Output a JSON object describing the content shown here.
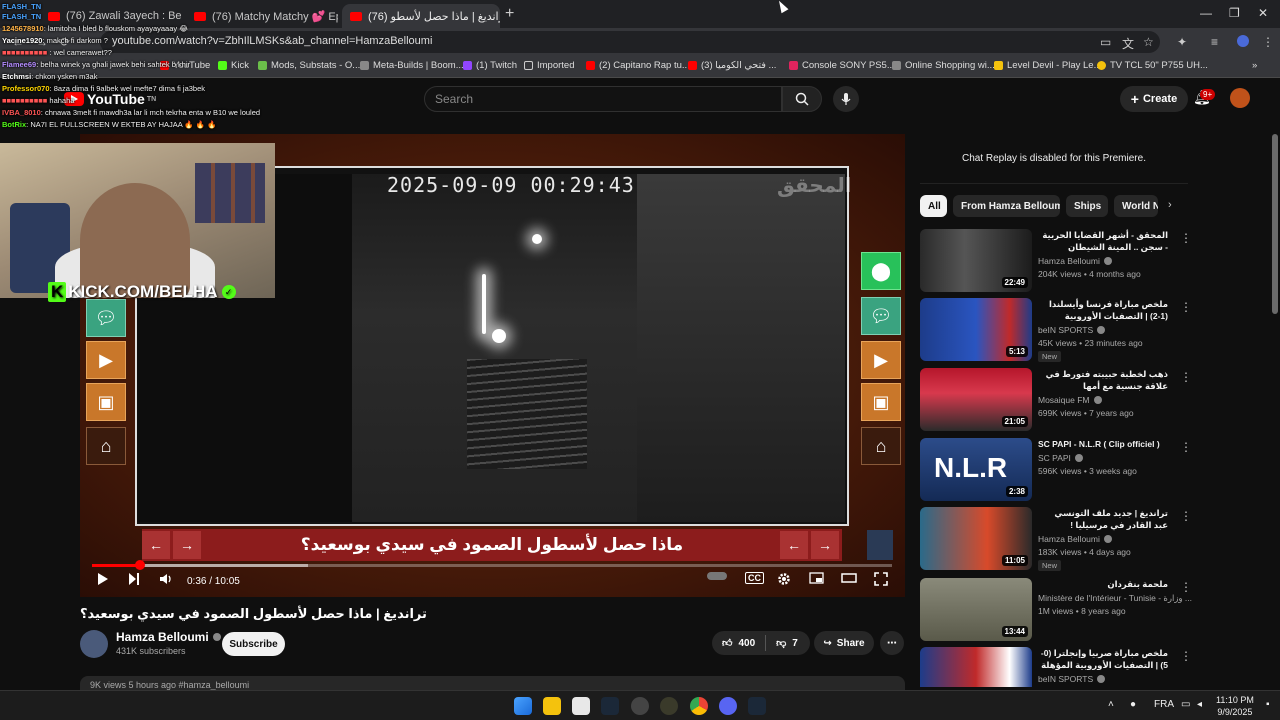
{
  "browser": {
    "tabs": [
      {
        "label": "(76) Zawali 3ayech : Bendirman"
      },
      {
        "label": "(76) Matchy Matchy 💕 Ep 59: "
      },
      {
        "label": "ترانديغ | ماذا حصل لأسطو (76)"
      }
    ],
    "address": "youtube.com/watch?v=ZbhIlLMSKs&ab_channel=HamzaBelloumi",
    "bookmarks": [
      "YouTube",
      "Kick",
      "Mods, Substats - O...",
      "Meta-Builds | Boom...",
      "(1) Twitch",
      "Imported",
      "(2) Capitano Rap tu...",
      "(3) فتحي الكوميا ...",
      "Console SONY PS5...",
      "Online Shopping wi...",
      "Level Devil - Play Le...",
      "TV TCL 50\" P755 UH..."
    ]
  },
  "youtube": {
    "logo": "YouTube",
    "logo_region": "TN",
    "search_placeholder": "Search",
    "create_label": "Create",
    "notif_count": "9+"
  },
  "player": {
    "timestamp": "2025-09-09 00:29:43",
    "watermark": "المحقق",
    "caption": "ماذا حصل لأسطول الصمود في سيدي بوسعيد؟",
    "current_time": "0:36",
    "duration": "10:05",
    "time_display": "0:36 / 10:05",
    "progress_played": 0.06,
    "progress_loaded": 0.27
  },
  "webcam": {
    "label": "KICK.COM/BELHA"
  },
  "chat": [
    {
      "user": "FLASH_TN",
      "text": ""
    },
    {
      "user": "FLASH_TN",
      "text": ""
    },
    {
      "user": "1245678910",
      "text": ": lamitoha I bled b flouskom ayayayaaay 😂"
    },
    {
      "user": "Yacine1920",
      "text": ": makch fi darkom ?"
    },
    {
      "user": "",
      "text": "wel camerawet??"
    },
    {
      "user": "Flamee69",
      "text": ": belha winek ya ghali jawek behi sahtek b khir"
    },
    {
      "user": "Etchmsi",
      "text": ": chkon ysken m3ak"
    },
    {
      "user": "Professor070",
      "text": ": 8aza dima fi 9albek wel mefte7 dima fi ja3bek"
    },
    {
      "user": "",
      "text": "hahaha"
    },
    {
      "user": "IVBA_8010",
      "text": ": chnawa 3melt fi mawdh3a lar li mch tekrha enta w B10 we louled"
    },
    {
      "user": "BotRix",
      "text": ": NA7I EL FULLSCREEN W EKTEB AY HAJAA 🔥 🔥 🔥"
    }
  ],
  "video": {
    "title": "ترانديغ | ماذا حصل لأسطول الصمود في سيدي بوسعيد؟",
    "channel": "Hamza Belloumi",
    "subscribers": "431K subscribers",
    "subscribe_label": "Subscribe",
    "likes": "400",
    "dislikes": "7",
    "share_label": "Share",
    "desc_peek": "9K views  5 hours ago  #hamza_belloumi"
  },
  "sidebar": {
    "chat_replay": "Chat Replay is disabled for this Premiere.",
    "chips": [
      "All",
      "From Hamza Belloumi",
      "Ships",
      "World N"
    ],
    "recs": [
      {
        "title": "المحقق - أشهر القضايا الحربية - سجن .. المينة الشيطان",
        "channel": "Hamza Belloumi",
        "meta": "204K views • 4 months ago",
        "duration": "22:49",
        "new": ""
      },
      {
        "title": "ملخص مباراة فرنسا وأيسلندا (1-2) | التصفيات الأوروبية المؤهلة لكأس العالم...",
        "channel": "beIN SPORTS",
        "meta": "45K views • 23 minutes ago",
        "duration": "5:13",
        "new": "New"
      },
      {
        "title": "ذهب لخطبة حبيبته فتورط في علاقة جنسية مع أمها",
        "channel": "Mosaique FM",
        "meta": "699K views • 7 years ago",
        "duration": "21:05",
        "new": ""
      },
      {
        "title": "SC PAPI - N.L.R ( Clip officiel )",
        "channel": "SC PAPI",
        "meta": "596K views • 3 weeks ago",
        "duration": "2:38",
        "new": ""
      },
      {
        "title": "ترانديغ | جديد ملف التونسي عبد القادر في مرسيليا !",
        "channel": "Hamza Belloumi",
        "meta": "183K views • 4 days ago",
        "duration": "11:05",
        "new": "New"
      },
      {
        "title": "ملحمة بنقردان",
        "channel": "Ministère de l'Intérieur - Tunisie - وزارة ...",
        "meta": "1M views • 8 years ago",
        "duration": "13:44",
        "new": ""
      },
      {
        "title": "ملخص مباراة صربيا وإنجلترا (0-5) | التصفيات الأوروبية المؤهلة لكأس العالم...",
        "channel": "beIN SPORTS",
        "meta": "",
        "duration": "",
        "new": ""
      }
    ]
  },
  "taskbar": {
    "lang": "FRA",
    "time": "11:10 PM",
    "date": "9/9/2025"
  },
  "colors": {
    "accent": "#ff0000",
    "kick_green": "#53fc18"
  }
}
